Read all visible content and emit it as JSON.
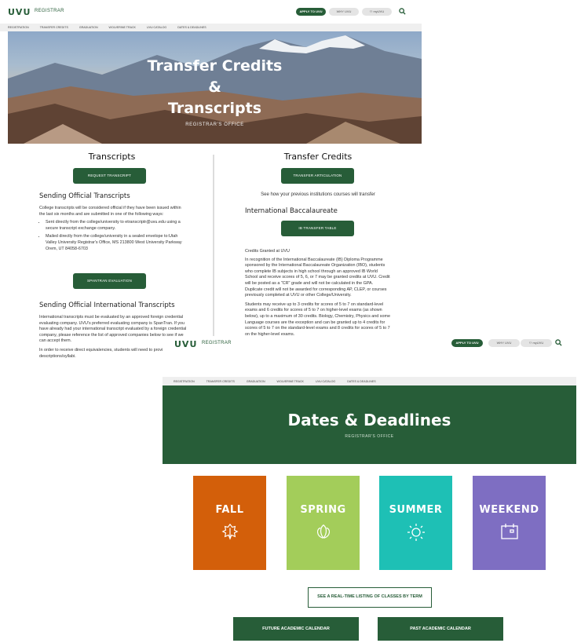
{
  "page1": {
    "logo": "UVU",
    "brand": "REGISTRAR",
    "apply_label": "APPLY TO UVU",
    "why_label": "WHY UVU",
    "myuvu_label": "myUVU",
    "nav": [
      "REGISTRATION",
      "TRANSFER CREDITS",
      "GRADUATION",
      "WOLVERINE TRACK",
      "UVU CATALOG",
      "DATES & DEADLINES"
    ],
    "hero": {
      "line1": "Transfer Credits",
      "line2": "&",
      "line3": "Transcripts",
      "subtitle": "REGISTRAR'S OFFICE"
    },
    "left": {
      "heading": "Transcripts",
      "request_button": "REQUEST TRANSCRIPT",
      "sending_heading": "Sending Official Transcripts",
      "sending_intro": "College transcripts will be considered official if they have been issued within the last six months and are submitted in one of the following ways:",
      "bullets": [
        "Sent directly from the college/university to etranscriptr@uvu.edu using a secure transcript exchange company.",
        "Mailed directly from the college/university in a sealed envelope to:Utah Valley University Registrar's Office, MS 213800 West University Parkway Orem, UT 84058-6703"
      ],
      "spantran_button": "SPANTRAN EVALUATION",
      "intl_heading": "Sending Official International Transcripts",
      "intl_p1": "International transcripts must be evaluated by an approved foreign credential evaluating company. UVU's preferred evaluating company is SpanTran. If you have already had your international transcript evaluated by a foreign credential company, please reference the list of approved companies below to see if we can accept them.",
      "intl_p2": "In order to receive direct equivalencies, students will need to provide course descriptions/syllabi."
    },
    "right": {
      "heading": "Transfer Credits",
      "articulation_button": "TRANSFER ARTICULATION",
      "see_text": "See how your previous institutions courses will transfer",
      "ib_heading": "International Baccalaureate",
      "ib_button": "IB TRANSFER TABLE",
      "credits_label": "Credits Granted at UVU",
      "p1": "In recognition of the International Baccalaureate (IB) Diploma Programme sponsored by the International Baccalaureate Organization (IBO), students who complete IB subjects in high school through an approved IB World School and receive scores of 5, 6, or 7 may be granted credits at UVU. Credit will be posted as a \"CR\" grade and will not be calculated in the GPA. Duplicate credit will not be awarded for corresponding AP, CLEP, or courses previously completed at UVU or other College/University.",
      "p2": "Students may receive up to 3 credits for scores of 5 to 7 on standard-level exams and 6 credits for scores of 5 to 7 on higher-level exams (as shown below), up to a maximum of 30 credits. Biology, Chemistry, Physics and some Language courses are the exception and can be granted up to 4 credits for scores of 5 to 7 on the standard-level exams and 8 credits for scores of 5 to 7 on the higher-level exams."
    }
  },
  "page2": {
    "logo": "UVU",
    "brand": "REGISTRAR",
    "apply_label": "APPLY TO UVU",
    "why_label": "WHY UVU",
    "myuvu_label": "myUVU",
    "nav": [
      "REGISTRATION",
      "TRANSFER CREDITS",
      "GRADUATION",
      "WOLVERINE TRACK",
      "UVU CATALOG",
      "DATES & DEADLINES"
    ],
    "banner_title": "Dates & Deadlines",
    "banner_subtitle": "REGISTRAR'S OFFICE",
    "tiles": [
      {
        "label": "FALL",
        "color": "#d35f0a",
        "icon": "leaf-icon"
      },
      {
        "label": "SPRING",
        "color": "#a3cd5a",
        "icon": "tulip-icon"
      },
      {
        "label": "SUMMER",
        "color": "#1ec0b5",
        "icon": "sun-icon"
      },
      {
        "label": "WEEKEND",
        "color": "#7e6ec2",
        "icon": "calendar-icon"
      }
    ],
    "listing_button": "SEE A REAL-TIME LISTING OF CLASSES BY TERM",
    "future_button": "FUTURE ACADEMIC CALENDAR",
    "past_button": "PAST ACADEMIC CALENDAR"
  },
  "colors": {
    "uvu_green": "#275d38",
    "nav_bg": "#efefef"
  }
}
